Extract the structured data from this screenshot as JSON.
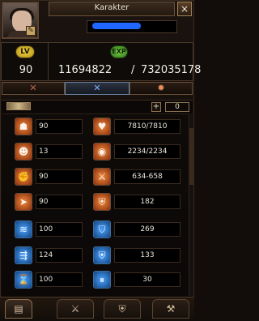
{
  "window": {
    "title": "Karakter",
    "close_label": "×"
  },
  "header": {
    "level_badge": "LV",
    "exp_badge": "EXP",
    "level": "90",
    "exp_current": "11694822",
    "exp_separator": "/",
    "exp_next": "732035178"
  },
  "tabs": [
    {
      "label": "✕",
      "kind": "combat-tab"
    },
    {
      "label": "✕",
      "kind": "skills-tab"
    },
    {
      "label": "✹",
      "kind": "emblem-tab"
    }
  ],
  "controls": {
    "add_point_label": "+",
    "available_points": "0"
  },
  "stats_left": [
    {
      "icon": "strength-icon",
      "value": "90"
    },
    {
      "icon": "mind-icon",
      "value": "13"
    },
    {
      "icon": "fist-icon",
      "value": "90"
    },
    {
      "icon": "speed-icon",
      "value": "90"
    },
    {
      "icon": "wind-attack-icon",
      "value": "100"
    },
    {
      "icon": "arrow-attack-icon",
      "value": "124"
    },
    {
      "icon": "hourglass-icon",
      "value": "100"
    }
  ],
  "stats_right": [
    {
      "icon": "heart-icon",
      "value": "7810/7810"
    },
    {
      "icon": "mana-icon",
      "value": "2234/2234"
    },
    {
      "icon": "sword-icon",
      "value": "634-658"
    },
    {
      "icon": "shield-icon",
      "value": "182"
    },
    {
      "icon": "armor-icon",
      "value": "269"
    },
    {
      "icon": "magic-shield-icon",
      "value": "133"
    },
    {
      "icon": "pillar-icon",
      "value": "30"
    }
  ],
  "bottom_tabs": [
    {
      "label": "▤",
      "name": "character-tab"
    },
    {
      "label": "⚔",
      "name": "equipment-tab"
    },
    {
      "label": "⛨",
      "name": "guild-tab"
    },
    {
      "label": "⚒",
      "name": "crafting-tab"
    }
  ]
}
